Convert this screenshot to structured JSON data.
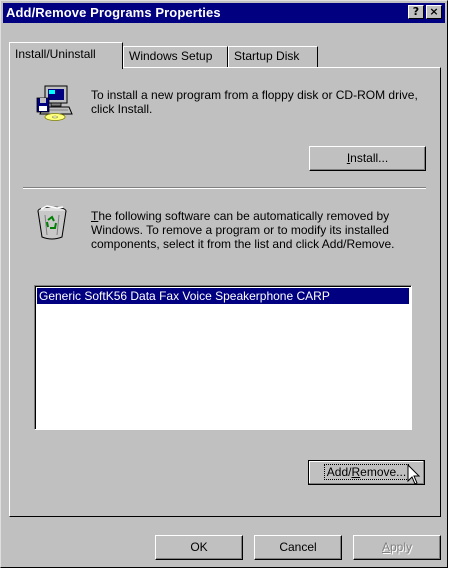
{
  "window": {
    "title": "Add/Remove Programs Properties",
    "help_button": "?",
    "close_button": "×"
  },
  "tabs": [
    {
      "label": "Install/Uninstall",
      "active": true
    },
    {
      "label": "Windows Setup",
      "active": false
    },
    {
      "label": "Startup Disk",
      "active": false
    }
  ],
  "install_section": {
    "icon": "computer-floppy-icon",
    "description": "To install a new program from a floppy disk or CD-ROM drive, click Install.",
    "button_label_prefix": "",
    "button_label_underlined": "I",
    "button_label_rest": "nstall..."
  },
  "remove_section": {
    "icon": "recycle-bin-icon",
    "description": "The following software can be automatically removed by Windows. To remove a program or to modify its installed components, select it from the list and click Add/Remove.",
    "desc_underlined": "T",
    "desc_rest": "he following software can be automatically removed by Windows. To remove a program or to modify its installed components, select it from the list and click Add/Remove.",
    "programs": [
      {
        "name": "Generic SoftK56 Data Fax Voice Speakerphone CARP",
        "selected": true
      }
    ],
    "button_label_prefix": "Add/",
    "button_label_underlined": "R",
    "button_label_rest": "emove..."
  },
  "footer": {
    "ok_label": "OK",
    "cancel_label": "Cancel",
    "apply_label": "Apply",
    "apply_underlined": "A",
    "apply_rest": "pply"
  },
  "colors": {
    "titlebar": "#000080",
    "face": "#c0c0c0",
    "selection": "#000080"
  }
}
